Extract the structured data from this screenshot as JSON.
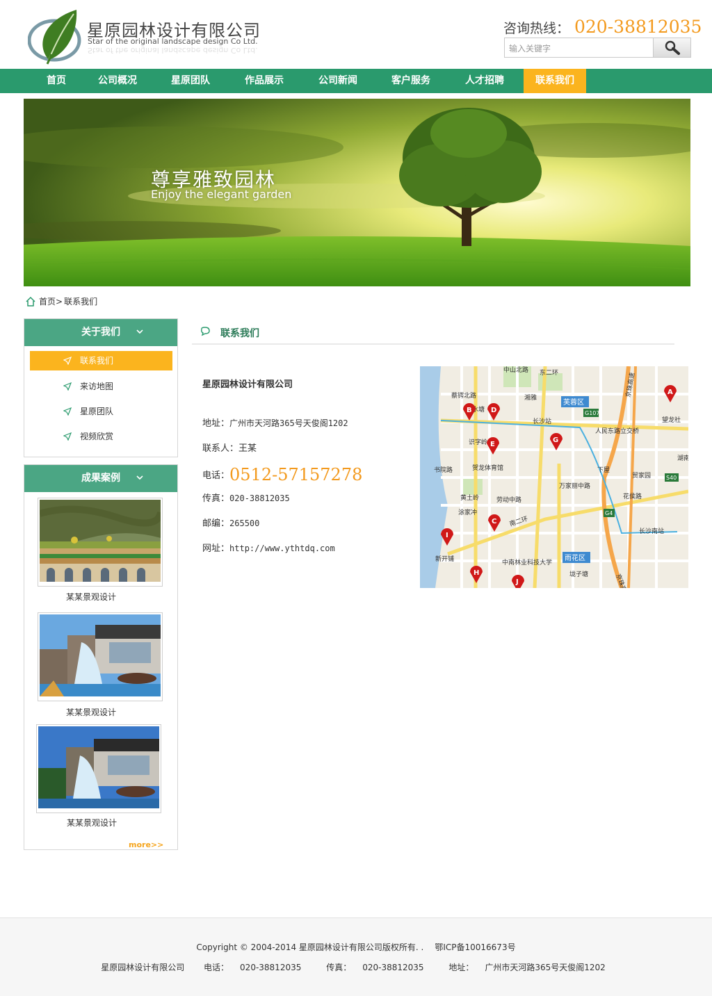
{
  "header": {
    "brand_cn": "星原园林设计有限公司",
    "brand_en": "Star of the original landscape design Co Ltd.",
    "hotline_label": "咨询热线：",
    "hotline_number": "020-38812035",
    "search_placeholder": "输入关键字",
    "colors": {
      "accent": "#f39a1e",
      "nav": "#2a9a6d",
      "nav_active": "#fbb41e"
    }
  },
  "nav": {
    "items": [
      {
        "label": "首页"
      },
      {
        "label": "公司概况"
      },
      {
        "label": "星原团队"
      },
      {
        "label": "作品展示"
      },
      {
        "label": "公司新闻"
      },
      {
        "label": "客户服务"
      },
      {
        "label": "人才招聘"
      },
      {
        "label": "联系我们",
        "active": true
      }
    ]
  },
  "banner": {
    "title_cn": "尊享雅致园林",
    "title_en": "Enjoy the elegant garden"
  },
  "breadcrumb": {
    "home": "首页>",
    "current": "联系我们"
  },
  "sidebar": {
    "about": {
      "title": "关于我们",
      "items": [
        {
          "label": "联系我们",
          "active": true
        },
        {
          "label": "来访地图"
        },
        {
          "label": "星原团队"
        },
        {
          "label": "视频欣赏"
        }
      ]
    },
    "cases": {
      "title": "成果案例",
      "items": [
        {
          "caption": "某某景观设计"
        },
        {
          "caption": "某某景观设计"
        },
        {
          "caption": "某某景观设计"
        }
      ],
      "more": "more>>"
    }
  },
  "content": {
    "title": "联系我们",
    "company": "星原园林设计有限公司",
    "address_label": "地址：",
    "address": "广州市天河路365号天俊阁1202",
    "contact_label": "联系人：",
    "contact": "王某",
    "phone_label": "电话：",
    "phone": "0512-57157278",
    "fax_label": "传真：",
    "fax": "020-38812035",
    "zip_label": "邮编：",
    "zip": "265500",
    "web_label": "网址：",
    "web": "http://www.ythtdq.com"
  },
  "map": {
    "labels": {
      "district_furong": "芙蓉区",
      "district_yuhua": "雨花区",
      "changsha_station": "长沙站",
      "changsha_south": "长沙南站",
      "caie": "蔡锷北路",
      "shuifeng": "水塘",
      "xiangya": "湘雅",
      "shizi": "识字岭",
      "shuyuan": "书院路",
      "helong": "贺龙体育馆",
      "huangtuling": "黄土岭",
      "laodong": "劳动中路",
      "tujia": "涂家冲",
      "xinkai": "新开铺",
      "linye": "中南林业科技大学",
      "erhuan": "南二环",
      "renmin": "人民东路立交桥",
      "xiawu": "下屋",
      "maojia": "贸家园",
      "wanjia": "万家丽中路",
      "huahou": "花侯路",
      "jingzhu": "京珠高速",
      "jingzhu2": "京珠高速",
      "g107": "G107",
      "g4": "G4",
      "s40": "S40",
      "dongerhuan": "东二环",
      "zhongshan": "中山北路",
      "wanglong": "望龙社",
      "hushi": "湖南",
      "fangzi": "垅子塘"
    },
    "markers": [
      "A",
      "B",
      "C",
      "D",
      "E",
      "G",
      "H",
      "I",
      "J"
    ]
  },
  "footer": {
    "copyright": "Copyright © 2004-2014  星原园林设计有限公司版权所有. .",
    "icp": "鄂ICP备10016673号",
    "company": "星原园林设计有限公司",
    "phone_label": "电话：",
    "phone": "020-38812035",
    "fax_label": "传真：",
    "fax": "020-38812035",
    "address_label": "地址：",
    "address": "广州市天河路365号天俊阁1202"
  }
}
